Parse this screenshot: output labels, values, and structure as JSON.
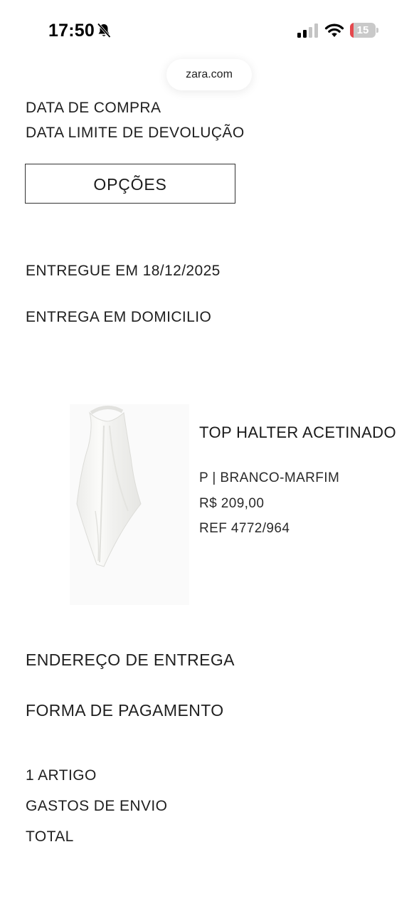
{
  "status_bar": {
    "time": "17:50",
    "battery_level": "15",
    "icons": [
      "bell-slash-icon",
      "cellular-signal-icon",
      "wifi-icon",
      "battery-icon"
    ]
  },
  "browser": {
    "url": "zara.com"
  },
  "order": {
    "purchase_date_label": "DATA DE COMPRA",
    "return_deadline_label": "DATA LIMITE DE DEVOLUÇÃO",
    "options_button": "OPÇÕES",
    "delivered_status": "ENTREGUE EM 18/12/2025",
    "delivery_method": "ENTREGA EM DOMICILIO"
  },
  "product": {
    "name": "TOP HALTER ACETINADO",
    "size_color": "P | BRANCO-MARFIM",
    "price": "R$ 209,00",
    "reference": "REF 4772/964"
  },
  "sections": {
    "delivery_address": "ENDEREÇO DE ENTREGA",
    "payment_method": "FORMA DE PAGAMENTO"
  },
  "summary": {
    "items_count": "1 ARTIGO",
    "shipping": "GASTOS DE ENVIO",
    "total": "TOTAL"
  },
  "colors": {
    "battery_low": "#e5484d",
    "text": "#1f1f1f",
    "background": "#ffffff"
  }
}
